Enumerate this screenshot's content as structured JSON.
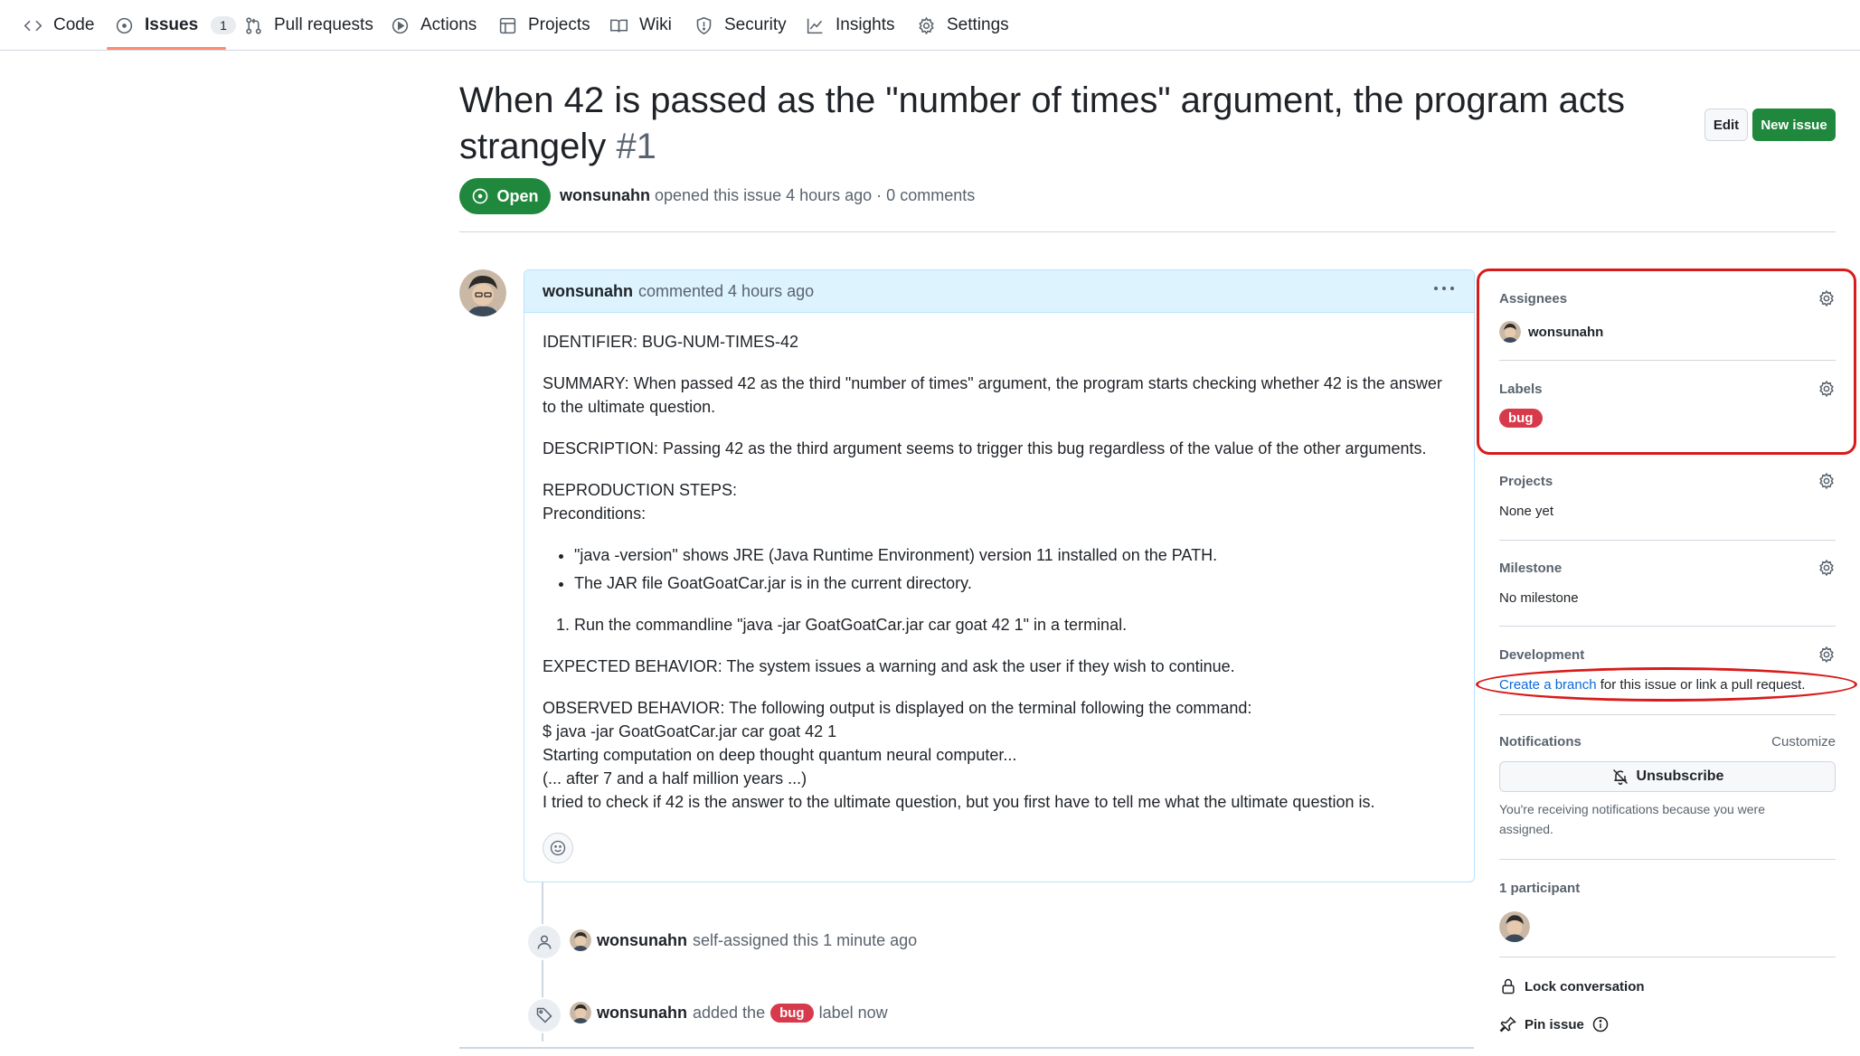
{
  "nav": {
    "tabs": [
      {
        "label": "Code",
        "icon": "code-icon"
      },
      {
        "label": "Issues",
        "icon": "issue-opened-icon",
        "count": "1"
      },
      {
        "label": "Pull requests",
        "icon": "git-pull-request-icon"
      },
      {
        "label": "Actions",
        "icon": "play-icon"
      },
      {
        "label": "Projects",
        "icon": "table-icon"
      },
      {
        "label": "Wiki",
        "icon": "book-icon"
      },
      {
        "label": "Security",
        "icon": "shield-icon"
      },
      {
        "label": "Insights",
        "icon": "graph-icon"
      },
      {
        "label": "Settings",
        "icon": "gear-icon"
      }
    ],
    "active_tab": "Issues"
  },
  "issue": {
    "title": "When 42 is passed as the \"number of times\" argument, the program acts strangely",
    "number": "#1",
    "state": "Open",
    "author": "wonsunahn",
    "meta_rest": "opened this issue 4 hours ago · 0 comments",
    "edit_label": "Edit",
    "new_issue_label": "New issue"
  },
  "comment": {
    "author": "wonsunahn",
    "header_rest": "commented 4 hours ago",
    "identifier": "IDENTIFIER: BUG-NUM-TIMES-42",
    "summary": "SUMMARY: When passed 42 as the third \"number of times\" argument, the program starts checking whether 42 is the answer to the ultimate question.",
    "description": "DESCRIPTION: Passing 42 as the third argument seems to trigger this bug regardless of the value of the other arguments.",
    "repro_heading": "REPRODUCTION STEPS:",
    "preconditions": "Preconditions:",
    "bullets": [
      "\"java -version\" shows JRE (Java Runtime Environment) version 11 installed on the PATH.",
      "The JAR file GoatGoatCar.jar is in the current directory."
    ],
    "steps": [
      "Run the commandline \"java -jar GoatGoatCar.jar car goat 42 1\" in a terminal."
    ],
    "expected": "EXPECTED BEHAVIOR: The system issues a warning and ask the user if they wish to continue.",
    "observed_lines": [
      "OBSERVED BEHAVIOR: The following output is displayed on the terminal following the command:",
      "$ java -jar GoatGoatCar.jar car goat 42 1",
      "Starting computation on deep thought quantum neural computer...",
      "(... after 7 and a half million years ...)",
      "I tried to check if 42 is the answer to the ultimate question, but you first have to tell me what the ultimate question is."
    ]
  },
  "timeline": [
    {
      "actor": "wonsunahn",
      "text": "self-assigned this 1 minute ago",
      "icon": "person-icon"
    },
    {
      "actor": "wonsunahn",
      "text_before": "added the",
      "label": "bug",
      "text_after": "label now",
      "icon": "tag-icon"
    }
  ],
  "sidebar": {
    "assignees": {
      "title": "Assignees",
      "value": "wonsunahn"
    },
    "labels": {
      "title": "Labels",
      "value": "bug"
    },
    "projects": {
      "title": "Projects",
      "value": "None yet"
    },
    "milestone": {
      "title": "Milestone",
      "value": "No milestone"
    },
    "development": {
      "title": "Development",
      "link": "Create a branch",
      "rest": " for this issue or link a pull request."
    },
    "notifications": {
      "title": "Notifications",
      "customize": "Customize",
      "button": "Unsubscribe",
      "note": "You're receiving notifications because you were assigned."
    },
    "participants": {
      "title": "1 participant"
    },
    "lock": "Lock conversation",
    "pin": "Pin issue"
  },
  "colors": {
    "open_green": "#1f883d",
    "bug_red": "#d73a4a",
    "link_blue": "#0969da",
    "annotation_red": "#d81b1b"
  }
}
